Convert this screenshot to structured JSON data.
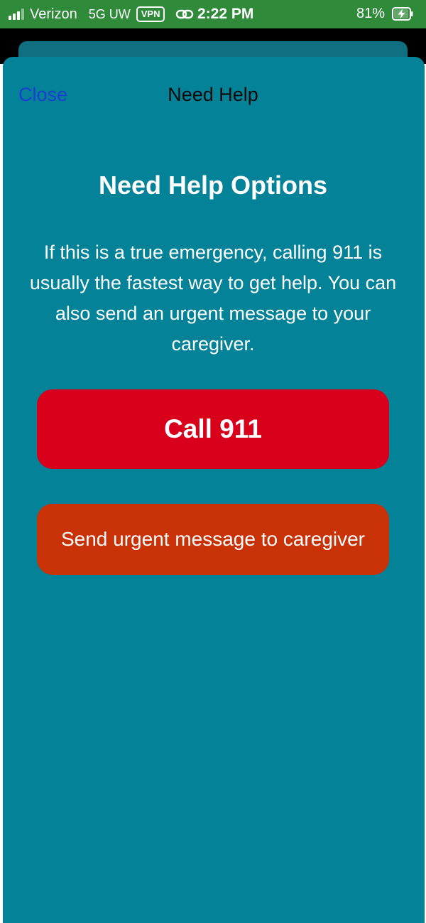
{
  "status_bar": {
    "carrier": "Verizon",
    "network": "5G UW",
    "vpn": "VPN",
    "time": "2:22 PM",
    "battery_percent": "81%",
    "icons": [
      "signal-icon",
      "link-icon",
      "battery-charging-icon"
    ]
  },
  "nav": {
    "close_label": "Close",
    "title": "Need Help"
  },
  "content": {
    "title": "Need Help Options",
    "description": "If this is a true emergency, calling 911 is usually the fastest way to get help. You can also send an urgent message to your caregiver."
  },
  "actions": {
    "call_label": "Call 911",
    "message_label": "Send urgent message to caregiver"
  },
  "colors": {
    "status_bar": "#2f8a3a",
    "sheet": "#038298",
    "close_link": "#1c3fd0",
    "call_button": "#d8001a",
    "message_button": "#c93106"
  }
}
